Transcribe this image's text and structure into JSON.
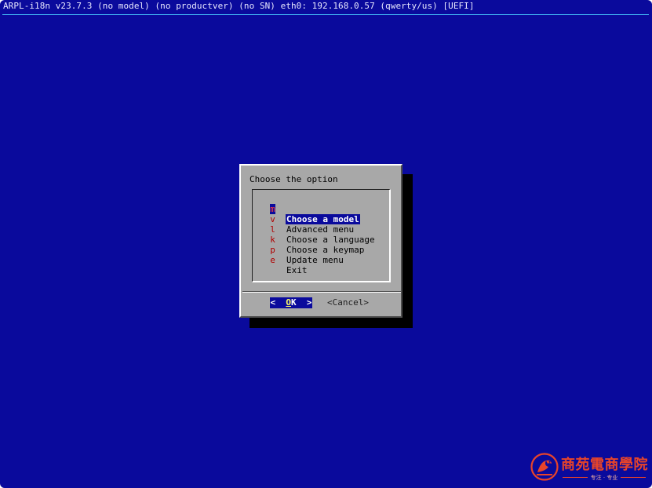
{
  "title_bar": "ARPL-i18n v23.7.3 (no model) (no productver) (no SN) eth0: 192.168.0.57 (qwerty/us) [UEFI]",
  "dialog": {
    "title": "Choose the option",
    "items": [
      {
        "key": "m",
        "label": "Choose a model",
        "selected": true
      },
      {
        "key": "v",
        "label": "Advanced menu",
        "selected": false
      },
      {
        "key": "l",
        "label": "Choose a language",
        "selected": false
      },
      {
        "key": "k",
        "label": "Choose a keymap",
        "selected": false
      },
      {
        "key": "p",
        "label": "Update menu",
        "selected": false
      },
      {
        "key": "e",
        "label": "Exit",
        "selected": false
      }
    ],
    "ok_left": "<",
    "ok_hot": "O",
    "ok_rest": "K",
    "ok_right": ">",
    "cancel_label": "<Cancel>"
  },
  "watermark": {
    "text": "商苑電商學院",
    "subtext": "专注 · 专业"
  },
  "colors": {
    "background": "#0a0a9c",
    "dialog": "#a8a8a8",
    "hotkey": "#b00000",
    "highlight_text": "#ffffff",
    "watermark": "#e8442a"
  }
}
